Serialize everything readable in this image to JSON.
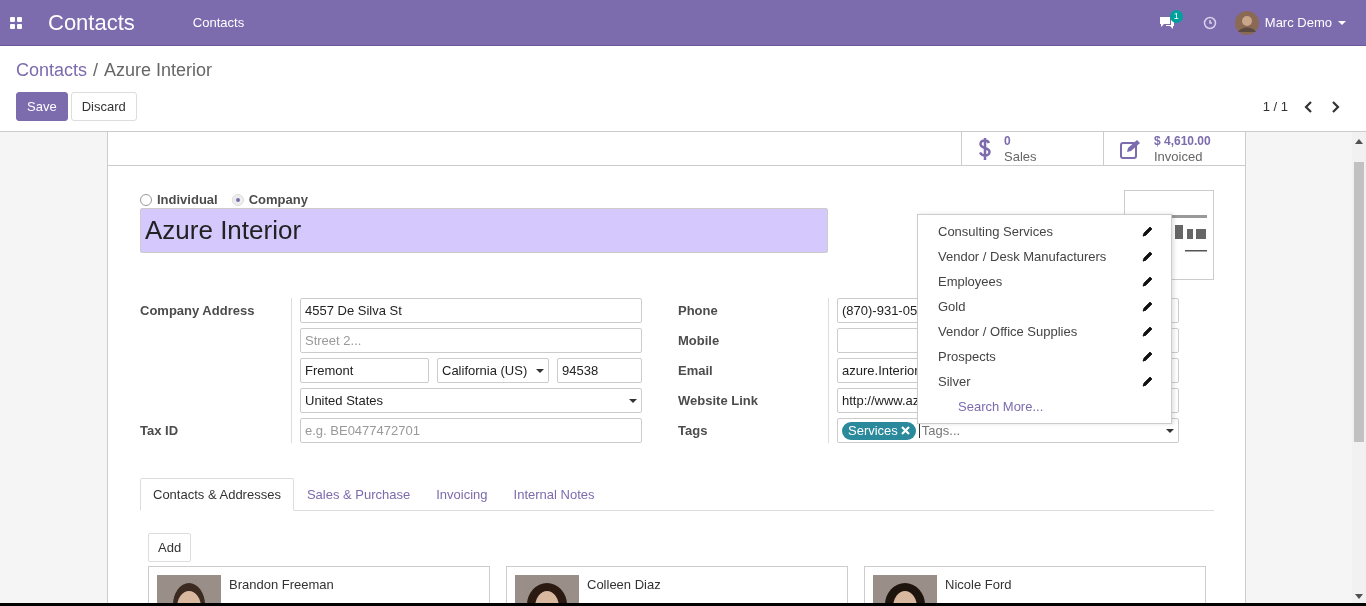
{
  "navbar": {
    "app_title": "Contacts",
    "menu": [
      "Contacts"
    ],
    "messages_badge": "1",
    "user": "Marc Demo"
  },
  "breadcrumb_separator": "/",
  "breadcrumb": [
    {
      "label": "Contacts"
    },
    {
      "label": "Azure Interior"
    }
  ],
  "buttons": [
    {
      "label": "Save",
      "kind": "primary"
    },
    {
      "label": "Discard",
      "kind": "secondary"
    }
  ],
  "pager": "1 / 1",
  "stat_buttons": [
    {
      "kind": "dollar",
      "value": "0",
      "label": "Sales"
    },
    {
      "kind": "edit",
      "value": "$ 4,610.00",
      "label": "Invoiced"
    }
  ],
  "company_type": [
    {
      "label": "Individual",
      "selected": false
    },
    {
      "label": "Company",
      "selected": true
    }
  ],
  "name": "Azure Interior",
  "address": {
    "label": "Company Address",
    "street": "4557 De Silva St",
    "street2_placeholder": "Street 2...",
    "city": "Fremont",
    "state": "California (US)",
    "zip": "94538",
    "country": "United States"
  },
  "tax_id": {
    "label": "Tax ID",
    "placeholder": "e.g. BE0477472701"
  },
  "contact_fields": [
    {
      "label": "Phone",
      "value": "(870)-931-05"
    },
    {
      "label": "Mobile"
    },
    {
      "label": "Email",
      "value": "azure.Interior"
    },
    {
      "label": "Website Link",
      "value": "http://www.az"
    }
  ],
  "tags": {
    "label": "Tags",
    "selected": [
      "Services"
    ],
    "placeholder": "Tags..."
  },
  "tag_dropdown": {
    "options": [
      "Consulting Services",
      "Vendor / Desk Manufacturers",
      "Employees",
      "Gold",
      "Vendor / Office Supplies",
      "Prospects",
      "Silver"
    ],
    "search_more": "Search More..."
  },
  "tabs": [
    {
      "label": "Contacts & Addresses",
      "selected": true
    },
    {
      "label": "Sales & Purchase",
      "selected": false
    },
    {
      "label": "Invoicing",
      "selected": false
    },
    {
      "label": "Internal Notes",
      "selected": false
    }
  ],
  "add_button": "Add",
  "contacts": [
    {
      "name": "Brandon Freeman"
    },
    {
      "name": "Colleen Diaz"
    },
    {
      "name": "Nicole Ford"
    }
  ]
}
